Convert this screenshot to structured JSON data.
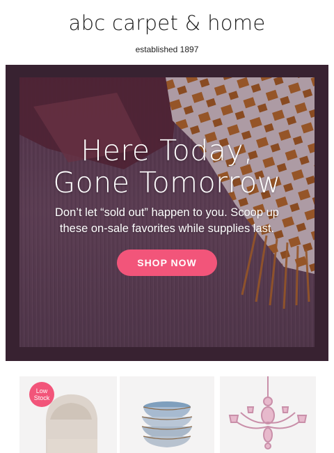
{
  "header": {
    "logo": "abc carpet & home",
    "tagline": "established 1897"
  },
  "hero": {
    "headline_line1": "Here Today,",
    "headline_line2": "Gone Tomorrow",
    "subtext_line1": "Don’t let “sold out” happen to you. Scoop up",
    "subtext_line2": "these on-sale favorites while supplies last.",
    "cta_label": "SHOP NOW"
  },
  "products": [
    {
      "image": "upholstered-armchair",
      "badge_line1": "Low",
      "badge_line2": "Stock"
    },
    {
      "image": "stacked-ceramic-bowls"
    },
    {
      "image": "pink-glass-chandelier"
    }
  ],
  "colors": {
    "accent_pink": "#f2557a",
    "hero_purple": "#4a2f42",
    "card_bg": "#f4f3f3"
  }
}
